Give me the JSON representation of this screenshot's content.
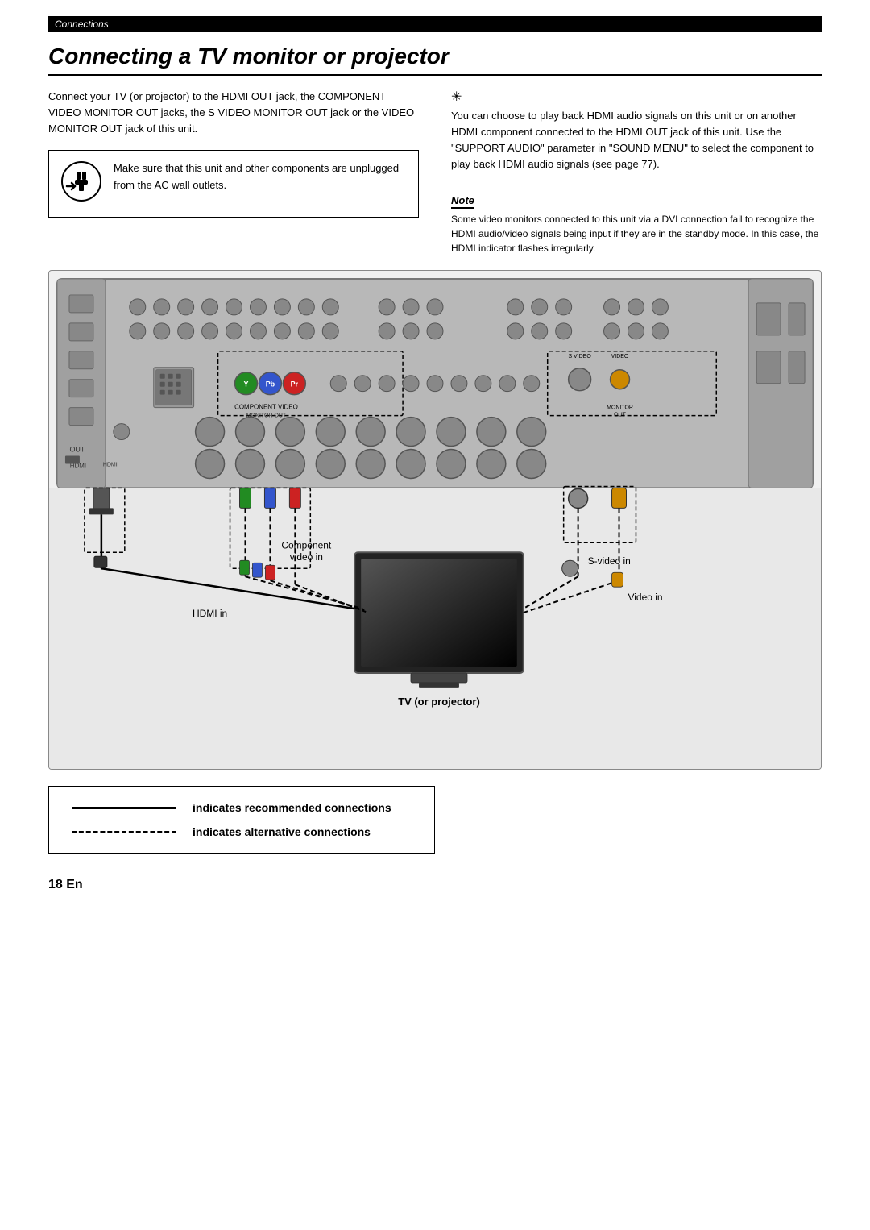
{
  "breadcrumb": "Connections",
  "title": "Connecting a TV monitor or projector",
  "intro_left_p1": "Connect your TV (or projector) to the HDMI OUT jack, the COMPONENT VIDEO MONITOR OUT jacks, the S VIDEO MONITOR OUT jack or the VIDEO MONITOR OUT jack of this unit.",
  "warning_text": "Make sure that this unit and other components are unplugged from the AC wall outlets.",
  "tip_symbol": "✳",
  "intro_right_p1": "You can choose to play back HDMI audio signals on this unit or on another HDMI component connected to the HDMI OUT jack of this unit. Use the \"SUPPORT AUDIO\" parameter in \"SOUND MENU\" to select the component to play back HDMI audio signals (see page 77).",
  "note_label": "Note",
  "note_text": "Some video monitors connected to this unit via a DVI connection fail to recognize the HDMI audio/video signals being input if they are in the standby mode. In this case, the HDMI indicator flashes irregularly.",
  "diagram": {
    "tv_label": "TV (or projector)",
    "component_label": "Component\nvideo in",
    "hdmi_label": "HDMI in",
    "svideo_label": "S-video in",
    "video_label": "Video in"
  },
  "legend": {
    "solid_label": "indicates recommended connections",
    "dashed_label": "indicates alternative connections"
  },
  "page_number": "18 En"
}
